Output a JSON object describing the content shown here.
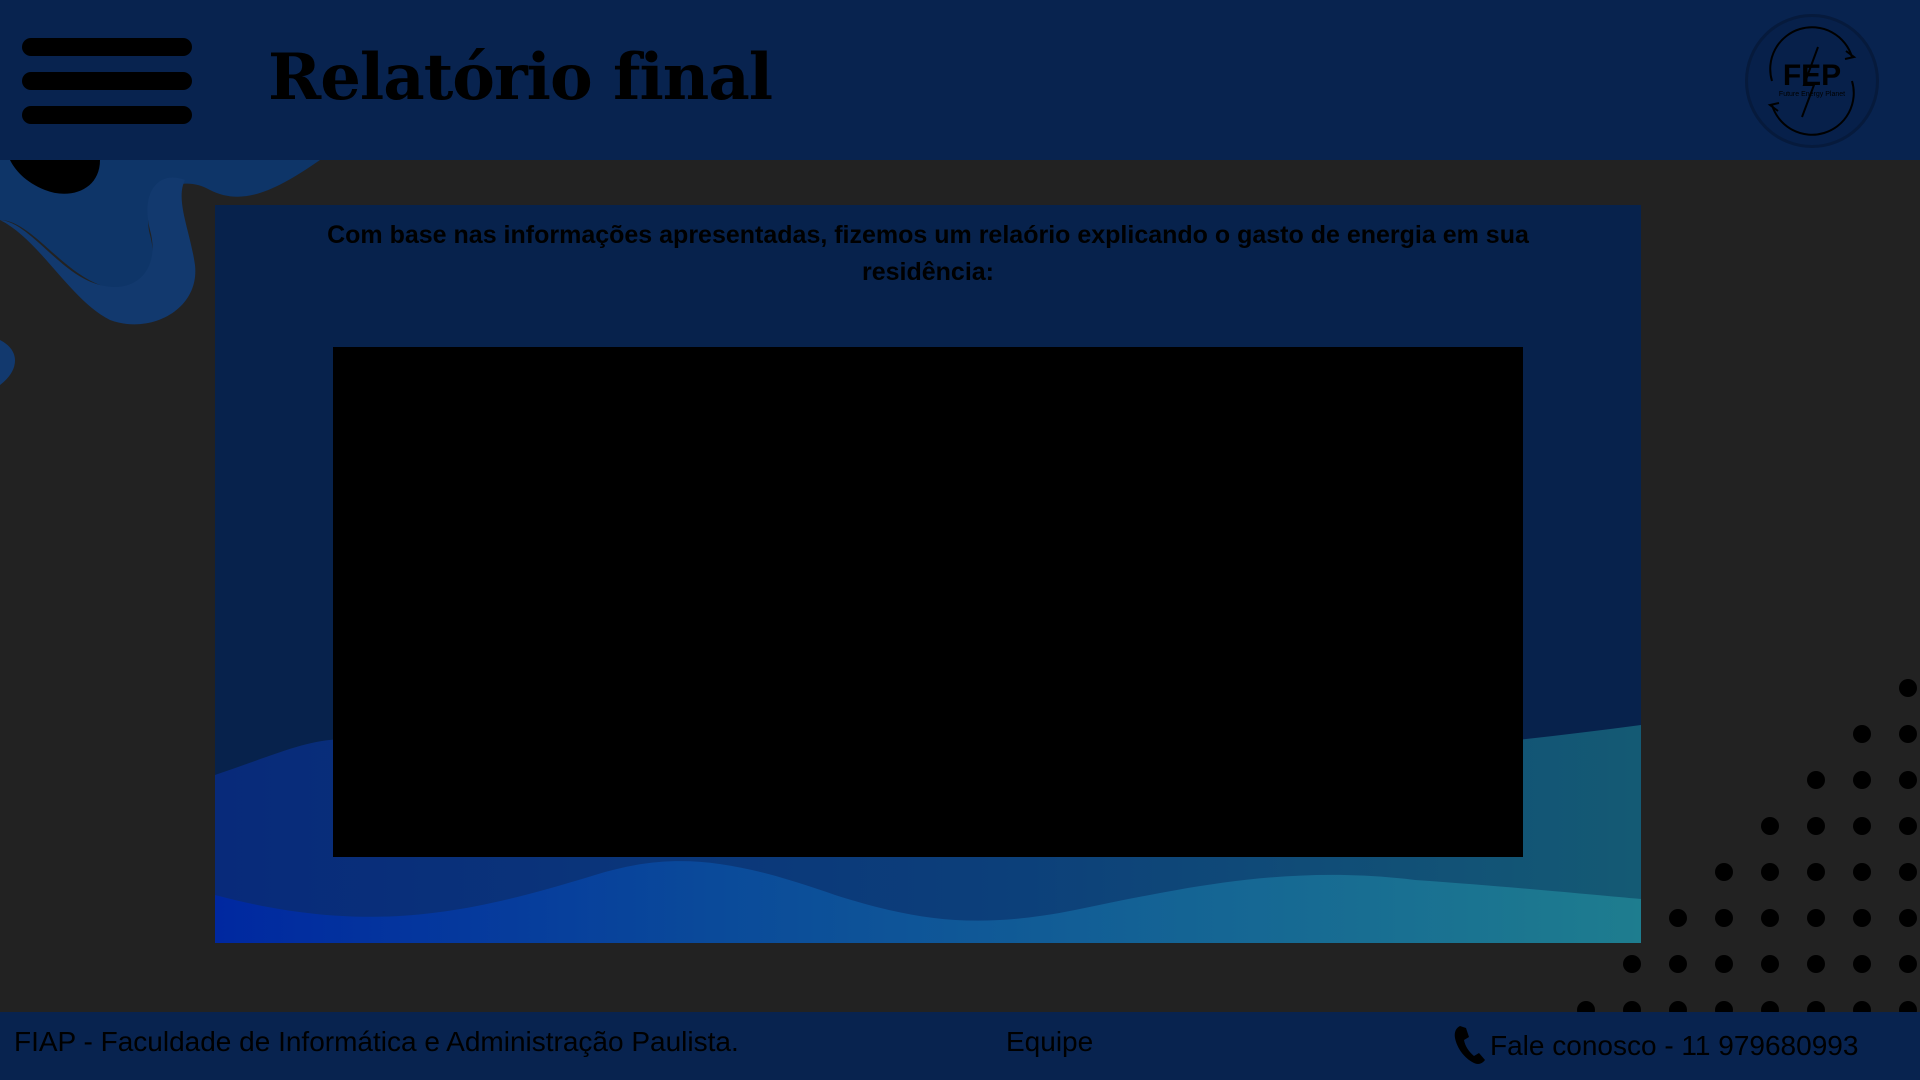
{
  "header": {
    "title": "Relatório final",
    "menu_icon": "hamburger-menu-icon",
    "logo": {
      "text": "FEP",
      "subtext": "Future Energy Planet"
    }
  },
  "main": {
    "intro_text": "Com base nas informações apresentadas, fizemos um relaório explicando o gasto de energia em sua residência:"
  },
  "footer": {
    "institution": "FIAP - Faculdade de Informática e Administração Paulista.",
    "team_link": "Equipe",
    "contact": "Fale conosco - 11 979680993",
    "phone_icon": "phone-icon"
  },
  "colors": {
    "background": "#222222",
    "header": "#08234f",
    "panel": "#07224c",
    "frame": "#000000",
    "accent_teal": "#1e7d8f"
  }
}
